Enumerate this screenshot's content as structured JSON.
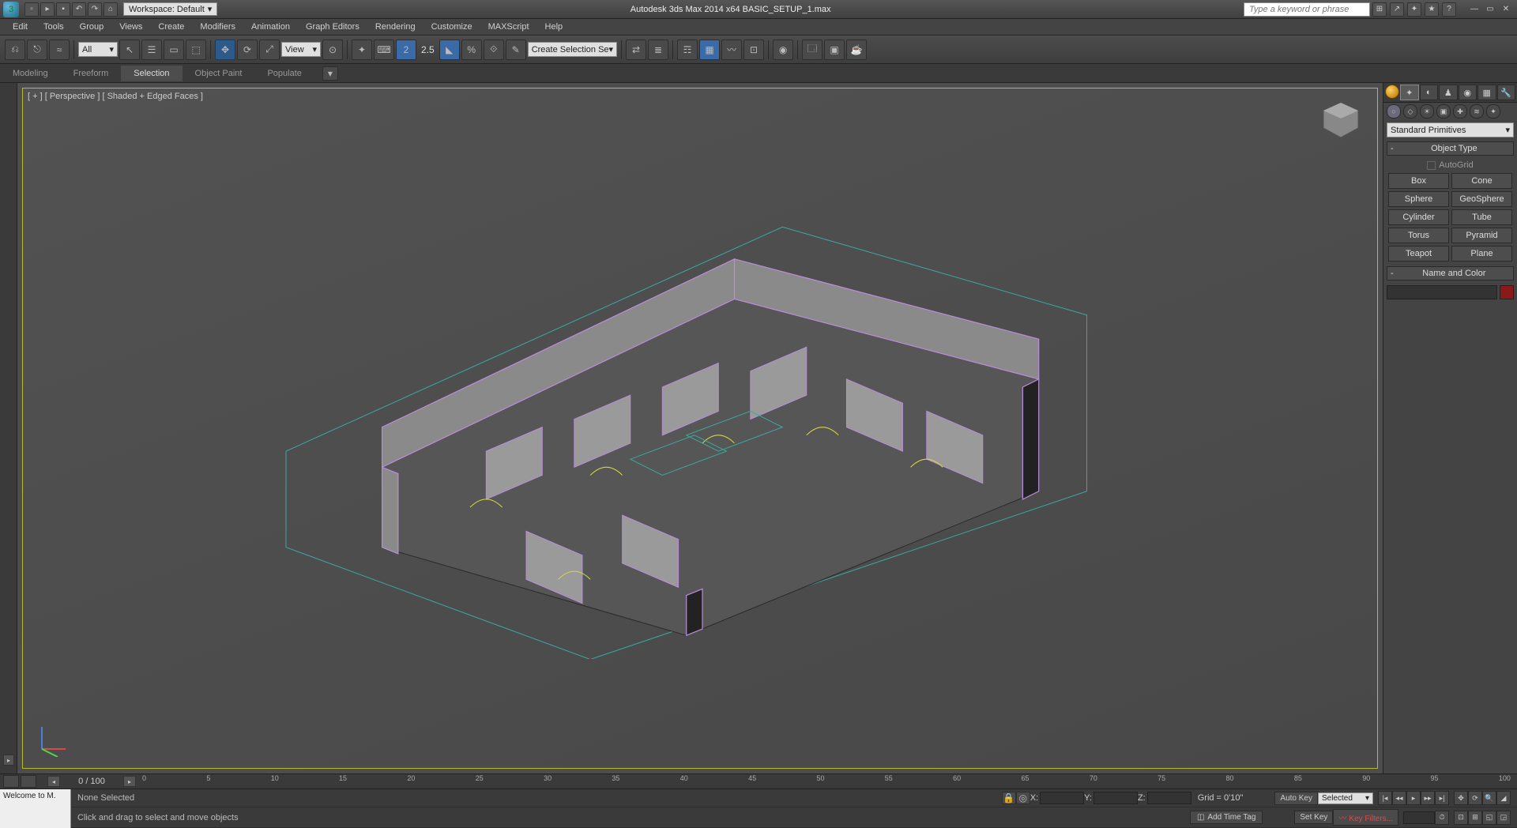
{
  "app": {
    "title": "Autodesk 3ds Max  2014 x64     BASIC_SETUP_1.max",
    "workspace_label": "Workspace: Default",
    "search_placeholder": "Type a keyword or phrase"
  },
  "menu": [
    "Edit",
    "Tools",
    "Group",
    "Views",
    "Create",
    "Modifiers",
    "Animation",
    "Graph Editors",
    "Rendering",
    "Customize",
    "MAXScript",
    "Help"
  ],
  "toolbar": {
    "selection_filter": "All",
    "ref_coord": "View",
    "spinner": "2.5",
    "named_sel": "Create Selection Se"
  },
  "ribbon_tabs": [
    "Modeling",
    "Freeform",
    "Selection",
    "Object Paint",
    "Populate"
  ],
  "ribbon_active": "Selection",
  "viewport": {
    "label": "[ + ] [ Perspective ] [ Shaded + Edged Faces ]"
  },
  "command_panel": {
    "category": "Standard Primitives",
    "rollout_object_type": "Object Type",
    "autogrid": "AutoGrid",
    "primitives": [
      [
        "Box",
        "Cone"
      ],
      [
        "Sphere",
        "GeoSphere"
      ],
      [
        "Cylinder",
        "Tube"
      ],
      [
        "Torus",
        "Pyramid"
      ],
      [
        "Teapot",
        "Plane"
      ]
    ],
    "rollout_name": "Name and Color"
  },
  "timeline": {
    "frame": "0 / 100",
    "ticks": [
      "0",
      "5",
      "10",
      "15",
      "20",
      "25",
      "30",
      "35",
      "40",
      "45",
      "50",
      "55",
      "60",
      "65",
      "70",
      "75",
      "80",
      "85",
      "90",
      "95",
      "100"
    ]
  },
  "status": {
    "welcome": "Welcome to M.",
    "selection": "None Selected",
    "prompt": "Click and drag to select and move objects",
    "coords": {
      "x": "X:",
      "y": "Y:",
      "z": "Z:"
    },
    "grid": "Grid = 0'10\"",
    "add_time_tag": "Add Time Tag",
    "auto_key": "Auto Key",
    "set_key": "Set Key",
    "selected": "Selected",
    "key_filters": "Key Filters..."
  }
}
